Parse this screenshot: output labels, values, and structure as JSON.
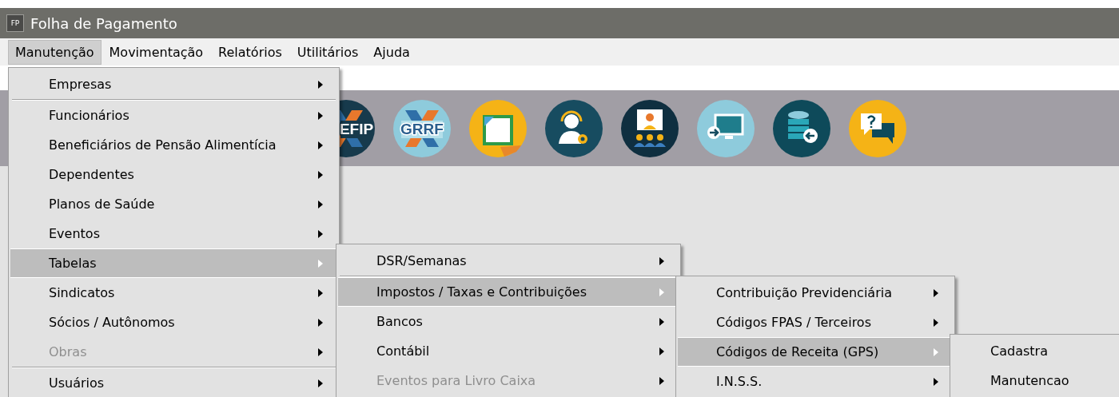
{
  "window": {
    "icon_label": "FP",
    "title": "Folha de Pagamento"
  },
  "menubar": [
    {
      "label": "Manutenção",
      "selected": true
    },
    {
      "label": "Movimentação",
      "selected": false
    },
    {
      "label": "Relatórios",
      "selected": false
    },
    {
      "label": "Utilitários",
      "selected": false
    },
    {
      "label": "Ajuda",
      "selected": false
    }
  ],
  "toolbar": [
    {
      "kind": "x-logo",
      "label": "EFIP"
    },
    {
      "kind": "x-logo-light",
      "label": "GRRF"
    },
    {
      "kind": "document"
    },
    {
      "kind": "support"
    },
    {
      "kind": "meeting"
    },
    {
      "kind": "monitor"
    },
    {
      "kind": "database"
    },
    {
      "kind": "help"
    }
  ],
  "menus": [
    {
      "items": [
        {
          "kind": "item",
          "label": "Empresas",
          "selected": false,
          "disabled": false,
          "submenu": true
        },
        {
          "kind": "separator"
        },
        {
          "kind": "item",
          "label": "Funcionários",
          "selected": false,
          "disabled": false,
          "submenu": true
        },
        {
          "kind": "item",
          "label": "Beneficiários de Pensão Alimentícia",
          "selected": false,
          "disabled": false,
          "submenu": true
        },
        {
          "kind": "item",
          "label": "Dependentes",
          "selected": false,
          "disabled": false,
          "submenu": true
        },
        {
          "kind": "item",
          "label": "Planos de Saúde",
          "selected": false,
          "disabled": false,
          "submenu": true
        },
        {
          "kind": "item",
          "label": "Eventos",
          "selected": false,
          "disabled": false,
          "submenu": true
        },
        {
          "kind": "item",
          "label": "Tabelas",
          "selected": true,
          "disabled": false,
          "submenu": true
        },
        {
          "kind": "item",
          "label": "Sindicatos",
          "selected": false,
          "disabled": false,
          "submenu": true
        },
        {
          "kind": "item",
          "label": "Sócios / Autônomos",
          "selected": false,
          "disabled": false,
          "submenu": true
        },
        {
          "kind": "item",
          "label": "Obras",
          "selected": false,
          "disabled": true,
          "submenu": true
        },
        {
          "kind": "separator"
        },
        {
          "kind": "item",
          "label": "Usuários",
          "selected": false,
          "disabled": false,
          "submenu": true
        }
      ]
    },
    {
      "items": [
        {
          "kind": "item",
          "label": "DSR/Semanas",
          "selected": false,
          "disabled": false,
          "submenu": true
        },
        {
          "kind": "separator"
        },
        {
          "kind": "item",
          "label": "Impostos / Taxas e Contribuições",
          "selected": true,
          "disabled": false,
          "submenu": true
        },
        {
          "kind": "item",
          "label": "Bancos",
          "selected": false,
          "disabled": false,
          "submenu": true
        },
        {
          "kind": "item",
          "label": "Contábil",
          "selected": false,
          "disabled": false,
          "submenu": true
        },
        {
          "kind": "item",
          "label": "Eventos para Livro Caixa",
          "selected": false,
          "disabled": true,
          "submenu": true
        }
      ]
    },
    {
      "items": [
        {
          "kind": "item",
          "label": "Contribuição Previdenciária",
          "selected": false,
          "disabled": false,
          "submenu": true
        },
        {
          "kind": "item",
          "label": "Códigos FPAS / Terceiros",
          "selected": false,
          "disabled": false,
          "submenu": true
        },
        {
          "kind": "item",
          "label": "Códigos de Receita (GPS)",
          "selected": true,
          "disabled": false,
          "submenu": true
        },
        {
          "kind": "item",
          "label": "I.N.S.S.",
          "selected": false,
          "disabled": false,
          "submenu": true
        }
      ]
    },
    {
      "items": [
        {
          "kind": "item",
          "label": "Cadastra",
          "selected": false,
          "disabled": false,
          "submenu": false
        },
        {
          "kind": "item",
          "label": "Manutencao",
          "selected": false,
          "disabled": false,
          "submenu": false
        }
      ]
    }
  ]
}
